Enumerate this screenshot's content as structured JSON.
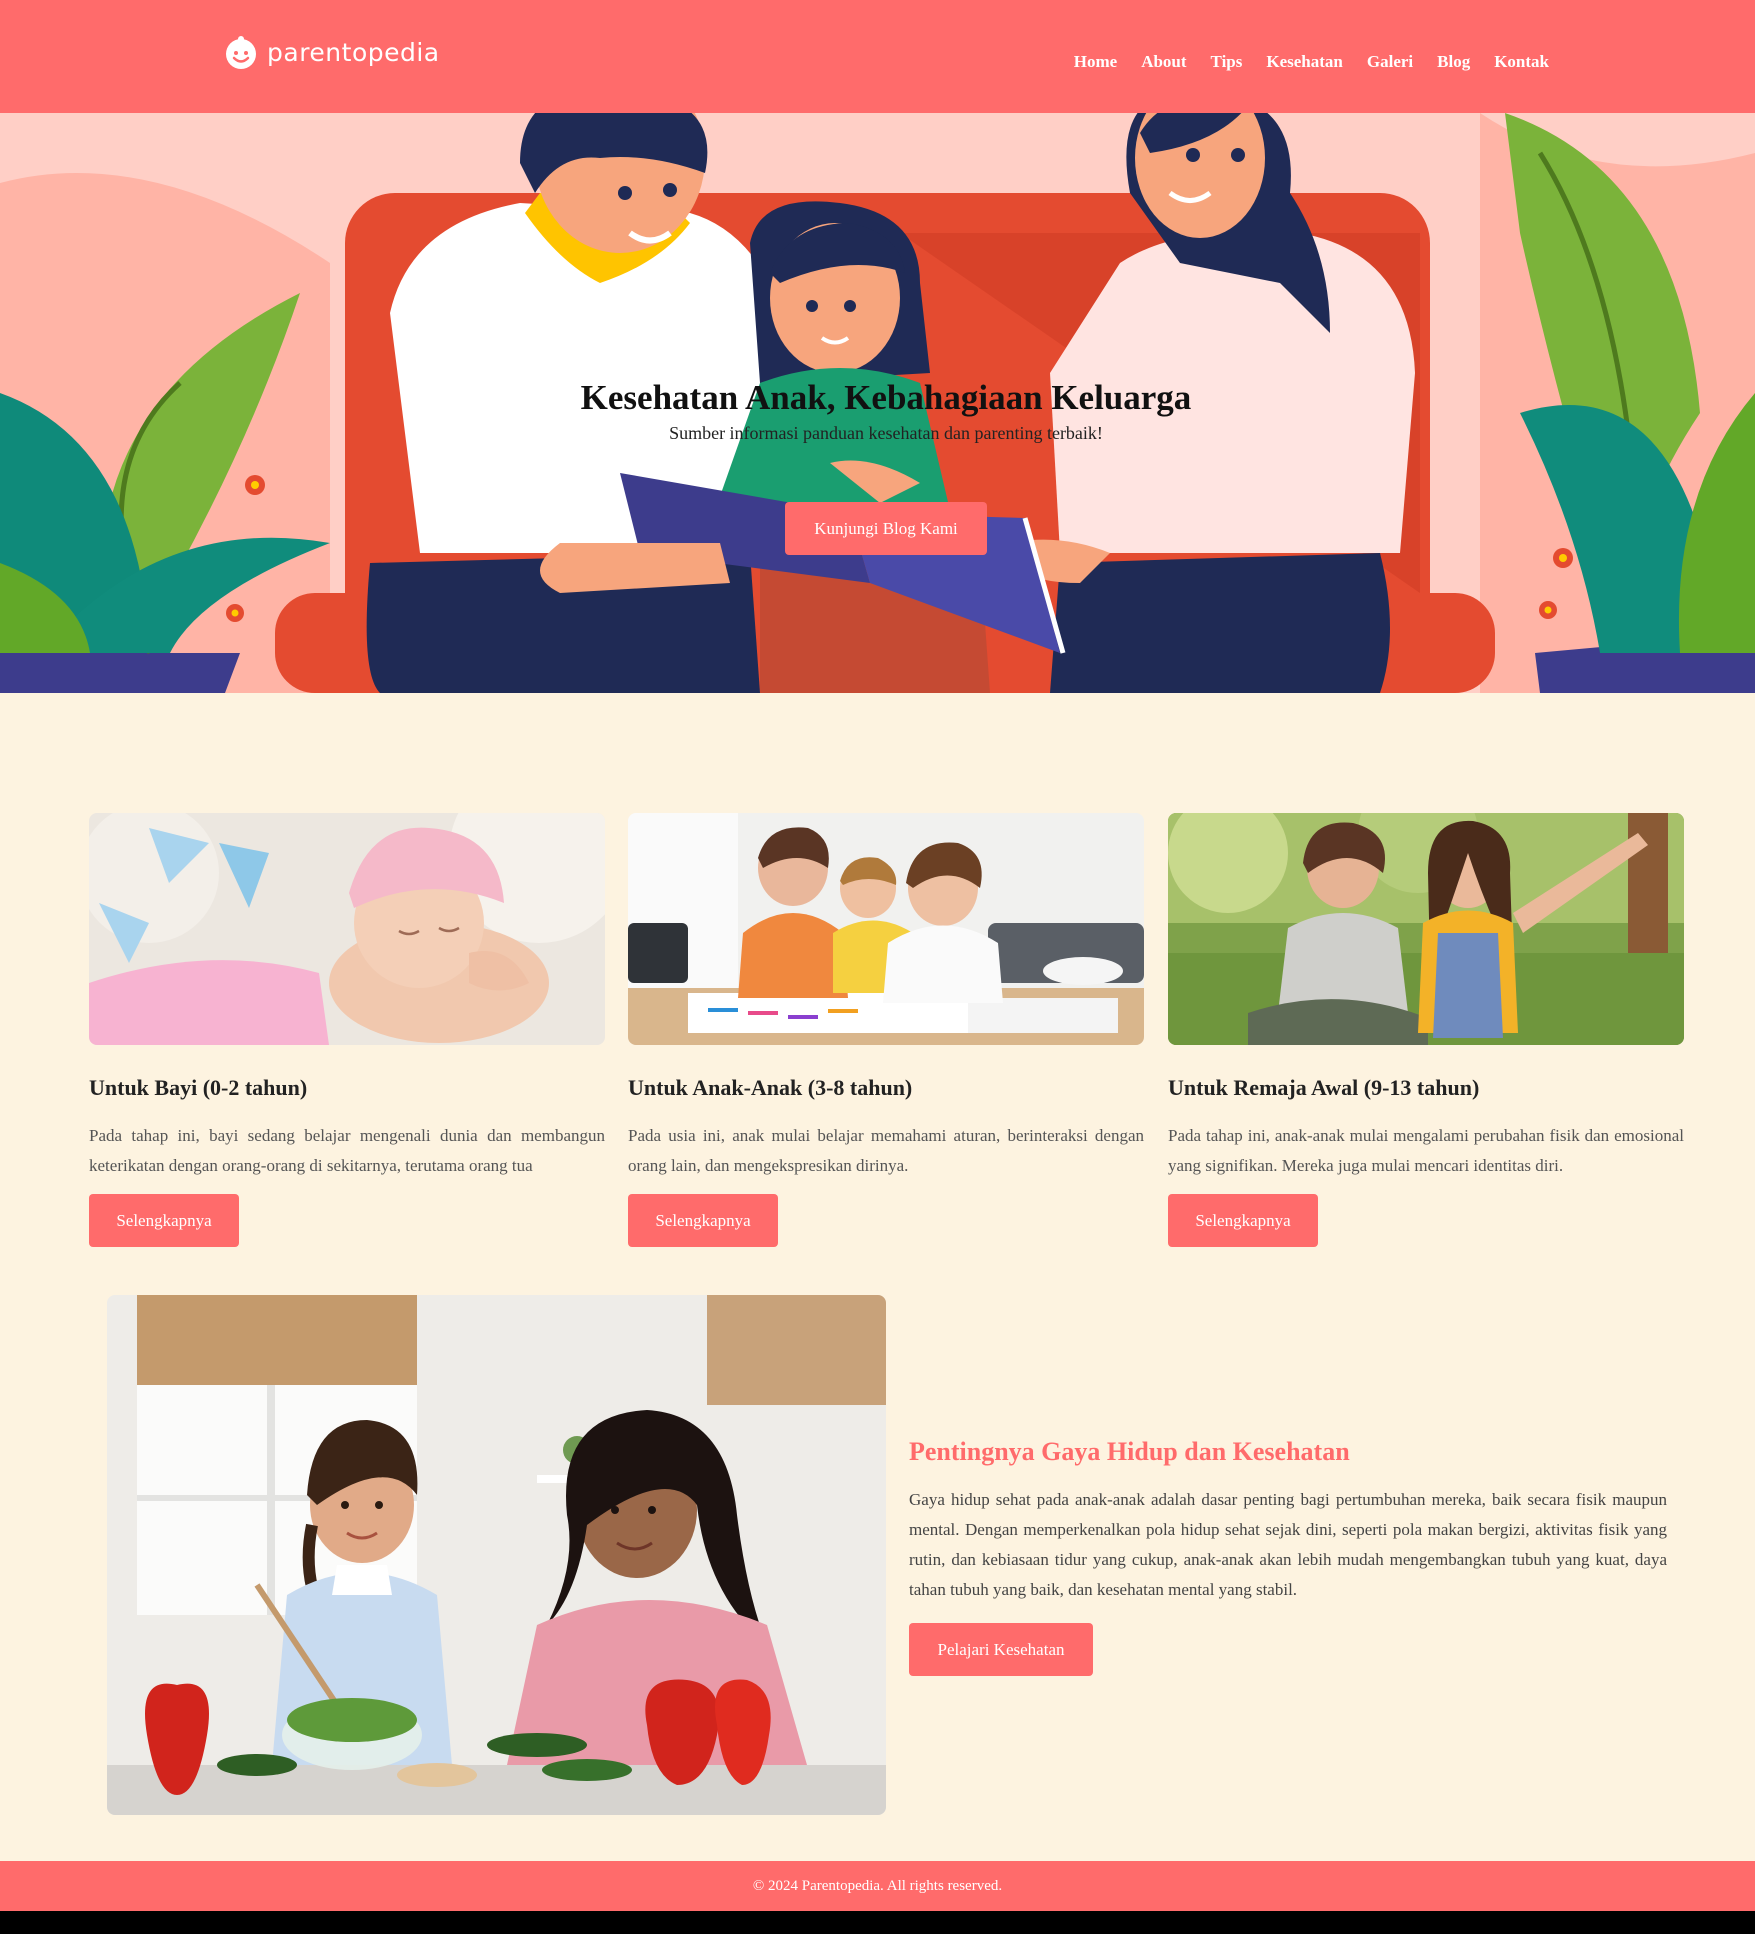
{
  "brand": {
    "name": "parentopedia"
  },
  "nav": {
    "items": [
      {
        "label": "Home"
      },
      {
        "label": "About"
      },
      {
        "label": "Tips"
      },
      {
        "label": "Kesehatan"
      },
      {
        "label": "Galeri"
      },
      {
        "label": "Blog"
      },
      {
        "label": "Kontak"
      }
    ]
  },
  "hero": {
    "title": "Kesehatan Anak, Kebahagiaan Keluarga",
    "subtitle": "Sumber informasi panduan kesehatan dan parenting terbaik!",
    "button": "Kunjungi Blog Kami"
  },
  "cards": [
    {
      "title": "Untuk Bayi (0-2 tahun)",
      "text": "Pada tahap ini, bayi sedang belajar mengenali dunia dan membangun keterikatan dengan orang-orang di sekitarnya, terutama orang tua",
      "button": "Selengkapnya"
    },
    {
      "title": "Untuk Anak-Anak (3-8 tahun)",
      "text": "Pada usia ini, anak mulai belajar memahami aturan, berinteraksi dengan orang lain, dan mengekspresikan dirinya.",
      "button": "Selengkapnya"
    },
    {
      "title": "Untuk Remaja Awal (9-13 tahun)",
      "text": "Pada tahap ini, anak-anak mulai mengalami perubahan fisik dan emosional yang signifikan. Mereka juga mulai mencari identitas diri.",
      "button": "Selengkapnya"
    }
  ],
  "feature": {
    "title": "Pentingnya Gaya Hidup dan Kesehatan",
    "text": "Gaya hidup sehat pada anak-anak adalah dasar penting bagi pertumbuhan mereka, baik secara fisik maupun mental. Dengan memperkenalkan pola hidup sehat sejak dini, seperti pola makan bergizi, aktivitas fisik yang rutin, dan kebiasaan tidur yang cukup, anak-anak akan lebih mudah mengembangkan tubuh yang kuat, daya tahan tubuh yang baik, dan kesehatan mental yang stabil.",
    "button": "Pelajari Kesehatan"
  },
  "footer": {
    "text": "© 2024 Parentopedia. All rights reserved."
  },
  "colors": {
    "primary": "#ff6b6b",
    "background": "#fdf3e0",
    "hero_bg": "#ffcfc6"
  }
}
